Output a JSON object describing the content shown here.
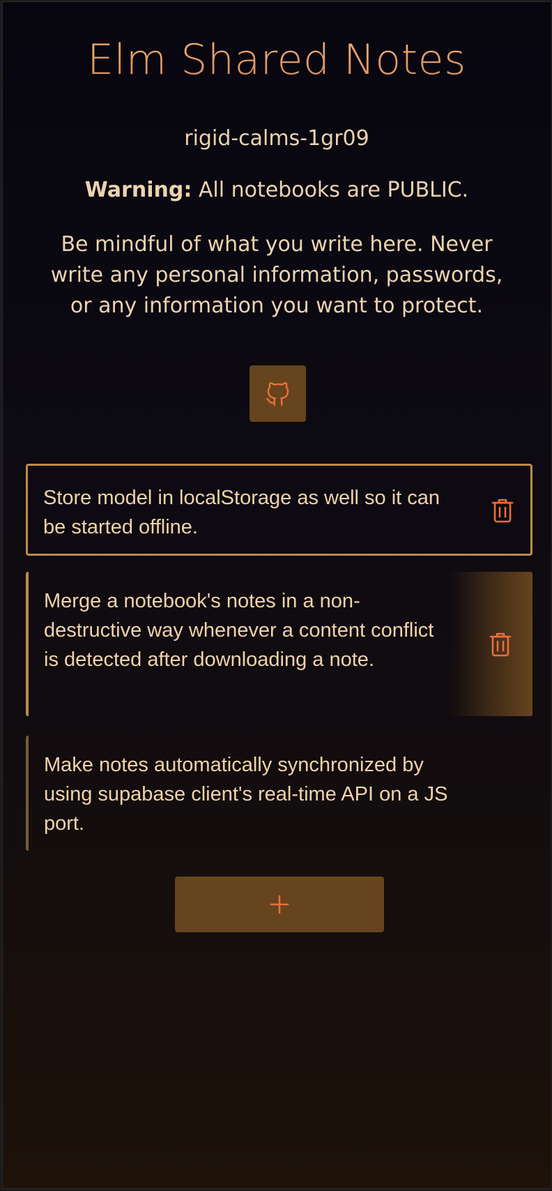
{
  "header": {
    "title": "Elm Shared Notes",
    "notebook_id": "rigid-calms-1gr09",
    "warning_label": "Warning:",
    "warning_text": "All notebooks are PUBLIC.",
    "mindful_text": "Be mindful of what you write here. Never write any personal information, passwords, or any information you want to protect."
  },
  "icons": {
    "github": "github-icon",
    "delete": "trash-icon",
    "add": "plus-icon"
  },
  "notes": [
    {
      "text": "Store model in localStorage as well so it can be started offline.",
      "state": "selected"
    },
    {
      "text": "Merge a notebook's notes in a non-destructive way whenever a content conflict is detected after downloading a note.",
      "state": "hover"
    },
    {
      "text": "Make notes automatically synchronized by using supabase client's real-time API on a JS port.",
      "state": "default"
    }
  ],
  "colors": {
    "accent": "#d98a58",
    "text": "#ecd3b0",
    "button_bg": "#66441d",
    "icon": "#e8703a",
    "background_top": "#07060f",
    "background_bottom": "#1e1209"
  }
}
